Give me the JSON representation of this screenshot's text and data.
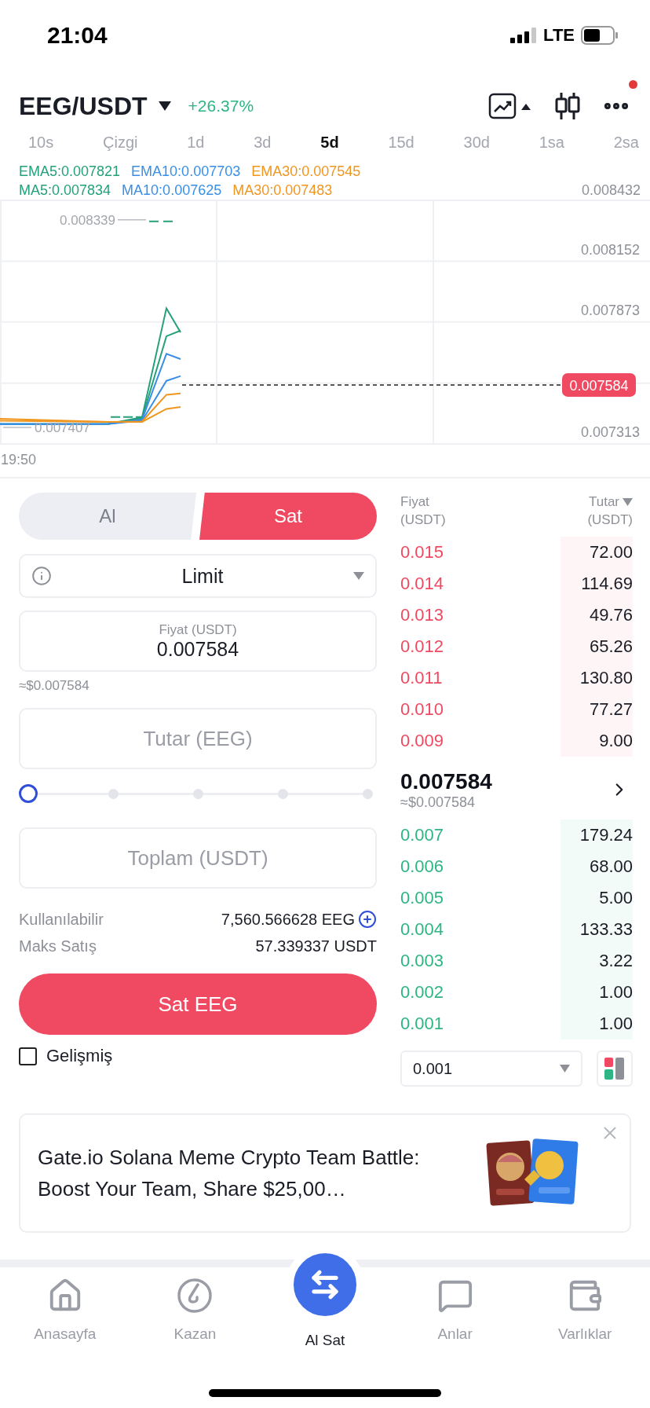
{
  "status_bar": {
    "time": "21:04",
    "network": "LTE"
  },
  "header": {
    "pair": "EEG/USDT",
    "change": "+26.37%",
    "notification": true
  },
  "intervals": [
    {
      "label": "10s",
      "selected": false
    },
    {
      "label": "Çizgi",
      "selected": false
    },
    {
      "label": "1d",
      "selected": false
    },
    {
      "label": "3d",
      "selected": false
    },
    {
      "label": "5d",
      "selected": true
    },
    {
      "label": "15d",
      "selected": false
    },
    {
      "label": "30d",
      "selected": false
    },
    {
      "label": "1sa",
      "selected": false
    },
    {
      "label": "2sa",
      "selected": false
    }
  ],
  "indicators": [
    [
      {
        "label": "EMA5:0.007821",
        "color": "#25a07a"
      },
      {
        "label": "EMA10:0.007703",
        "color": "#3a8ee6"
      },
      {
        "label": "EMA30:0.007545",
        "color": "#f0961e"
      }
    ],
    [
      {
        "label": "MA5:0.007834",
        "color": "#25a07a"
      },
      {
        "label": "MA10:0.007625",
        "color": "#3a8ee6"
      },
      {
        "label": "MA30:0.007483",
        "color": "#f0961e"
      }
    ]
  ],
  "chart": {
    "axis_labels": [
      "0.008432",
      "0.008152",
      "0.007873",
      "0.007313"
    ],
    "price_tag": "0.007584",
    "high_label": "0.008339",
    "low_label": "0.007407",
    "time_label": "19:50"
  },
  "trade_form": {
    "sides": [
      {
        "label": "Al",
        "selected": false
      },
      {
        "label": "Sat",
        "selected": true
      }
    ],
    "order_type": "Limit",
    "price_field": {
      "label": "Fiyat (USDT)",
      "value": "0.007584"
    },
    "price_usd": "≈$0.007584",
    "amount_field": {
      "placeholder": "Tutar (EEG)"
    },
    "slider": {
      "level": 0
    },
    "total_field": {
      "placeholder": "Toplam (USDT)"
    },
    "balances": [
      {
        "label": "Kullanılabilir",
        "value": "7,560.566628 EEG",
        "kind": "deposit"
      },
      {
        "label": "Maks Satış",
        "value": "57.339337 USDT",
        "kind": "plain"
      }
    ],
    "submit": "Sat EEG",
    "advanced": {
      "label": "Gelişmiş",
      "checked": false
    }
  },
  "order_book": {
    "price_header": {
      "title": "Fiyat",
      "unit": "(USDT)"
    },
    "amount_header": {
      "title": "Tutar",
      "unit": "(USDT)"
    },
    "asks": [
      {
        "price": "0.015",
        "amount": "72.00"
      },
      {
        "price": "0.014",
        "amount": "114.69"
      },
      {
        "price": "0.013",
        "amount": "49.76"
      },
      {
        "price": "0.012",
        "amount": "65.26"
      },
      {
        "price": "0.011",
        "amount": "130.80"
      },
      {
        "price": "0.010",
        "amount": "77.27"
      },
      {
        "price": "0.009",
        "amount": "9.00"
      }
    ],
    "last_price": "0.007584",
    "last_price_usd": "≈$0.007584",
    "bids": [
      {
        "price": "0.007",
        "amount": "179.24"
      },
      {
        "price": "0.006",
        "amount": "68.00"
      },
      {
        "price": "0.005",
        "amount": "5.00"
      },
      {
        "price": "0.004",
        "amount": "133.33"
      },
      {
        "price": "0.003",
        "amount": "3.22"
      },
      {
        "price": "0.002",
        "amount": "1.00"
      },
      {
        "price": "0.001",
        "amount": "1.00"
      }
    ],
    "precision": "0.001"
  },
  "banner": {
    "text": "Gate.io Solana Meme Crypto Team Battle: Boost Your Team, Share $25,00…"
  },
  "nav": [
    {
      "label": "Anasayfa",
      "kind": "home",
      "selected": false
    },
    {
      "label": "Kazan",
      "kind": "earn",
      "selected": false
    },
    {
      "label": "Al Sat",
      "kind": "trade",
      "selected": true
    },
    {
      "label": "Anlar",
      "kind": "moments",
      "selected": false
    },
    {
      "label": "Varlıklar",
      "kind": "wallet",
      "selected": false
    }
  ]
}
